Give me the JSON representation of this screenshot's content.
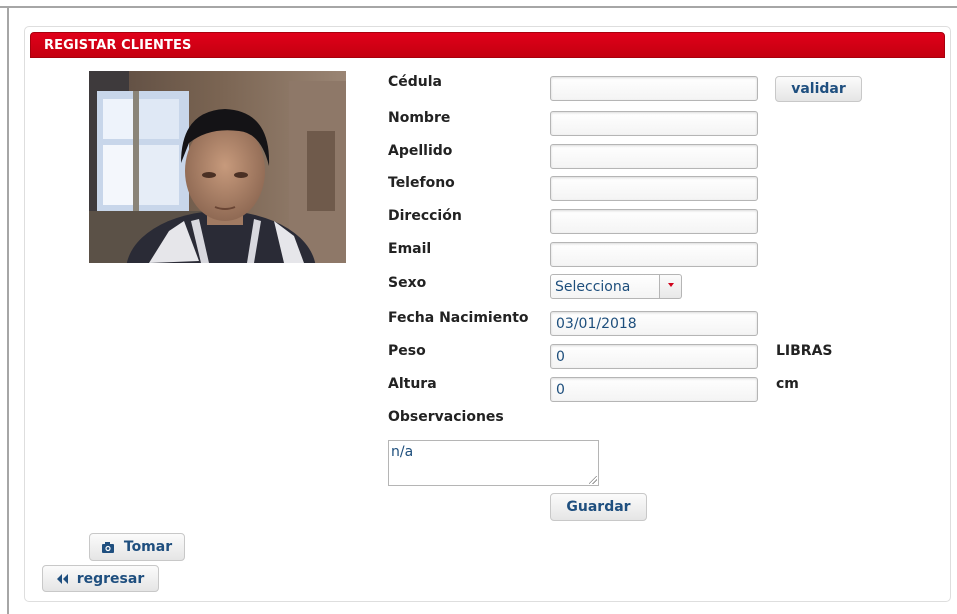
{
  "panel": {
    "title": "REGISTAR CLIENTES"
  },
  "form": {
    "cedula": {
      "label": "Cédula",
      "value": ""
    },
    "validar_label": "validar",
    "nombre": {
      "label": "Nombre",
      "value": ""
    },
    "apellido": {
      "label": "Apellido",
      "value": ""
    },
    "telefono": {
      "label": "Telefono",
      "value": ""
    },
    "direccion": {
      "label": "Dirección",
      "value": ""
    },
    "email": {
      "label": "Email",
      "value": ""
    },
    "sexo": {
      "label": "Sexo",
      "value": "Selecciona"
    },
    "fecha": {
      "label": "Fecha Nacimiento",
      "value": "03/01/2018"
    },
    "peso": {
      "label": "Peso",
      "value": "0",
      "unit": "LIBRAS"
    },
    "altura": {
      "label": "Altura",
      "value": "0",
      "unit": "cm"
    },
    "observaciones": {
      "label": "Observaciones",
      "value": "n/a"
    },
    "guardar_label": "Guardar"
  },
  "camera": {
    "tomar_label": "Tomar",
    "tomar_icon": "camera-icon"
  },
  "nav": {
    "regresar_label": "regresar",
    "regresar_icon": "double-left-arrow-icon"
  },
  "colors": {
    "header": "#d00014",
    "button_text": "#1f4f7f",
    "input_text": "#1d4e7c"
  }
}
